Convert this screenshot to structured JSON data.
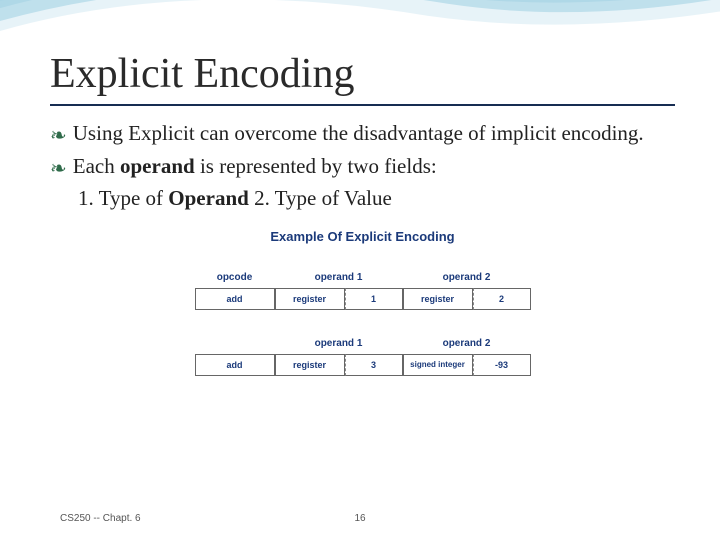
{
  "title": "Explicit Encoding",
  "bullets": [
    {
      "pre": "Using Explicit can overcome the disadvantage of implicit encoding.",
      "bold": "",
      "post": ""
    },
    {
      "pre": "Each ",
      "bold": "operand",
      "post": " is represented by two fields:"
    }
  ],
  "subline": {
    "part1_pre": "1. Type of ",
    "part1_bold": "Operand",
    "spacer": "     ",
    "part2": "2. Type of Value"
  },
  "diagram": {
    "title": "Example Of Explicit Encoding",
    "row1": {
      "opcode_label": "opcode",
      "op1_label": "operand 1",
      "op2_label": "operand 2",
      "opcode": "add",
      "op1_type": "register",
      "op1_val": "1",
      "op2_type": "register",
      "op2_val": "2"
    },
    "row2": {
      "op1_label": "operand 1",
      "op2_label": "operand 2",
      "opcode": "add",
      "op1_type": "register",
      "op1_val": "3",
      "op2_type": "signed integer",
      "op2_val": "-93"
    }
  },
  "footer": {
    "left": "CS250 -- Chapt. 6",
    "page": "16"
  }
}
